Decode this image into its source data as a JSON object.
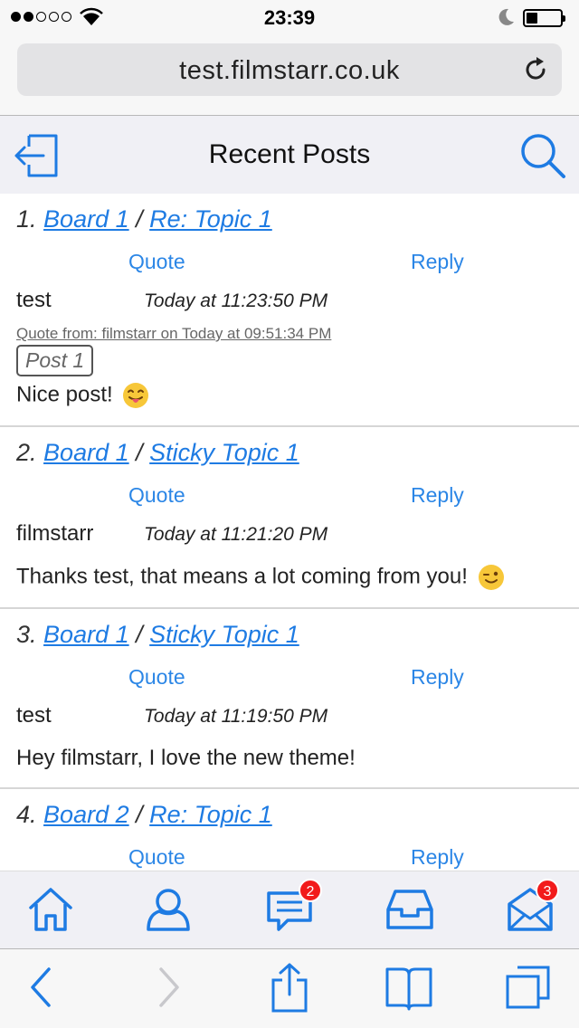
{
  "status_bar": {
    "time": "23:39"
  },
  "browser": {
    "url": "test.filmstarr.co.uk"
  },
  "header": {
    "title": "Recent Posts"
  },
  "posts": [
    {
      "number": "1.",
      "board": "Board 1",
      "separator": "/",
      "topic": "Re: Topic 1",
      "quote_label": "Quote",
      "reply_label": "Reply",
      "author": "test",
      "time": "Today at 11:23:50 PM",
      "quote_source": "Quote from: filmstarr on Today at 09:51:34 PM",
      "quote_text": "Post 1",
      "body": "Nice post!",
      "emoji": "tongue-out-emoji"
    },
    {
      "number": "2.",
      "board": "Board 1",
      "separator": "/",
      "topic": "Sticky Topic 1",
      "quote_label": "Quote",
      "reply_label": "Reply",
      "author": "filmstarr",
      "time": "Today at 11:21:20 PM",
      "body": "Thanks test, that means a lot coming from you!",
      "emoji": "wink-emoji"
    },
    {
      "number": "3.",
      "board": "Board 1",
      "separator": "/",
      "topic": "Sticky Topic 1",
      "quote_label": "Quote",
      "reply_label": "Reply",
      "author": "test",
      "time": "Today at 11:19:50 PM",
      "body": "Hey filmstarr, I love the new theme!"
    },
    {
      "number": "4.",
      "board": "Board 2",
      "separator": "/",
      "topic": "Re: Topic 1",
      "quote_label": "Quote",
      "reply_label": "Reply"
    }
  ],
  "tab_bar": {
    "items": [
      {
        "icon": "home-icon"
      },
      {
        "icon": "user-icon"
      },
      {
        "icon": "messages-icon",
        "badge": "2"
      },
      {
        "icon": "inbox-icon"
      },
      {
        "icon": "envelope-icon",
        "badge": "3"
      }
    ]
  },
  "toolbar": {
    "items": [
      "back-icon",
      "forward-icon",
      "share-icon",
      "bookmarks-icon",
      "tabs-icon"
    ]
  },
  "colors": {
    "accent": "#1e7be3",
    "badge": "#f21b1b"
  }
}
